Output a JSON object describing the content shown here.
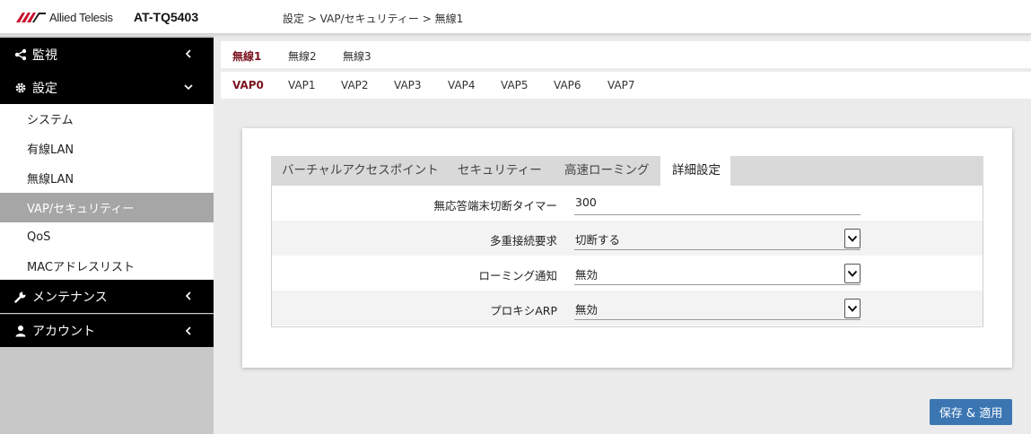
{
  "header": {
    "brand": "Allied Telesis",
    "model": "AT-TQ5403",
    "breadcrumb": "設定 > VAP/セキュリティー > 無線1"
  },
  "sidebar": {
    "groups": [
      {
        "label": "監視",
        "icon": "share-icon"
      },
      {
        "label": "設定",
        "icon": "gear-icon"
      },
      {
        "label": "メンテナンス",
        "icon": "wrench-icon"
      },
      {
        "label": "アカウント",
        "icon": "user-icon"
      }
    ],
    "items": [
      {
        "label": "システム"
      },
      {
        "label": "有線LAN"
      },
      {
        "label": "無線LAN"
      },
      {
        "label": "VAP/セキュリティー"
      },
      {
        "label": "QoS"
      },
      {
        "label": "MACアドレスリスト"
      }
    ]
  },
  "radio_tabs": [
    "無線1",
    "無線2",
    "無線3"
  ],
  "vap_tabs": [
    "VAP0",
    "VAP1",
    "VAP2",
    "VAP3",
    "VAP4",
    "VAP5",
    "VAP6",
    "VAP7"
  ],
  "sub_tabs": [
    "バーチャルアクセスポイント",
    "セキュリティー",
    "高速ローミング",
    "詳細設定"
  ],
  "form": {
    "rows": [
      {
        "label": "無応答端末切断タイマー",
        "value": "300"
      },
      {
        "label": "多重接続要求",
        "value": "切断する"
      },
      {
        "label": "ローミング通知",
        "value": "無効"
      },
      {
        "label": "プロキシARP",
        "value": "無効"
      }
    ]
  },
  "actions": {
    "save_label": "保存 & 適用"
  },
  "colors": {
    "accent": "#7b1420",
    "button": "#3b76b3",
    "sidebar_active": "#a6a6a6"
  }
}
